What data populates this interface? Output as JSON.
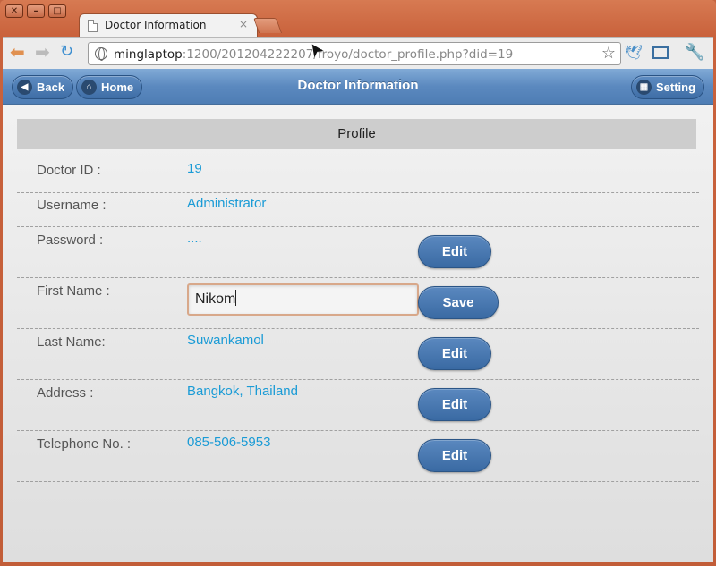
{
  "window": {
    "tab_title": "Doctor Information",
    "tab_close": "×"
  },
  "toolbar": {
    "url_host": "minglaptop",
    "url_rest": ":1200/201204222207/froyo/doctor_profile.php?did=19"
  },
  "header": {
    "title": "Doctor Information",
    "back_label": "Back",
    "home_label": "Home",
    "setting_label": "Setting"
  },
  "profile": {
    "section_title": "Profile",
    "fields": [
      {
        "label": "Doctor ID :",
        "value": "19"
      },
      {
        "label": "Username :",
        "value": "Administrator"
      },
      {
        "label": "Password :",
        "value": "....",
        "action": "Edit"
      },
      {
        "label": "First Name :",
        "value": "Nikom",
        "action": "Save"
      },
      {
        "label": "Last Name:",
        "value": "Suwankamol",
        "action": "Edit"
      },
      {
        "label": "Address :",
        "value": "Bangkok, Thailand",
        "action": "Edit"
      },
      {
        "label": "Telephone No. :",
        "value": "085-506-5953",
        "action": "Edit"
      }
    ]
  },
  "colors": {
    "header": "#5b89bf",
    "value_text": "#1a9bd6",
    "frame": "#c9623c"
  }
}
